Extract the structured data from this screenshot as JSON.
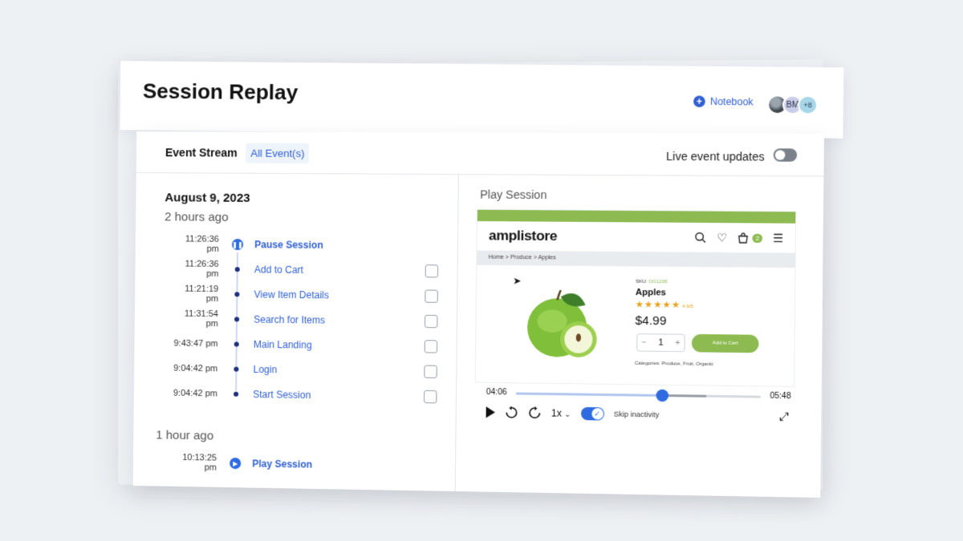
{
  "header": {
    "title": "Session Replay",
    "notebook_label": "Notebook",
    "avatars": [
      "BM",
      "+8"
    ]
  },
  "event_stream": {
    "title": "Event Stream",
    "filter": "All Event(s)",
    "live_label": "Live event updates",
    "live_enabled": false,
    "groups": [
      {
        "date": "August 9, 2023",
        "ago": "2 hours ago",
        "events": [
          {
            "time": "11:26:36 pm",
            "name": "Pause Session",
            "icon": "pause-icon"
          },
          {
            "time": "11:26:36 pm",
            "name": "Add to Cart",
            "icon": "dot"
          },
          {
            "time": "11:21:19 pm",
            "name": "View Item Details",
            "icon": "dot"
          },
          {
            "time": "11:31:54 pm",
            "name": "Search for Items",
            "icon": "dot"
          },
          {
            "time": "9:43:47 pm",
            "name": "Main Landing",
            "icon": "dot"
          },
          {
            "time": "9:04:42 pm",
            "name": "Login",
            "icon": "dot"
          },
          {
            "time": "9:04:42 pm",
            "name": "Start Session",
            "icon": "dot"
          }
        ]
      },
      {
        "ago": "1 hour ago",
        "events": [
          {
            "time": "10:13:25 pm",
            "name": "Play Session",
            "icon": "play-icon"
          }
        ]
      }
    ]
  },
  "player": {
    "label": "Play Session",
    "store": {
      "logo": "amplistore",
      "cart_count": "2",
      "breadcrumb": "Home  >  Produce  >  Apples",
      "sku_label": "SKU:",
      "sku": "OG1295",
      "product_name": "Apples",
      "rating": "4.9/5",
      "price": "$4.99",
      "quantity": "1",
      "add_to_cart": "Add to Cart",
      "categories": "Categories: Produce, Fruit, Organic"
    },
    "current_time": "04:06",
    "end_time": "05:48",
    "progress": 0.598,
    "buffered": 0.78,
    "speed": "1x",
    "skip_inactivity_label": "Skip inactivity",
    "skip_inactivity": true
  },
  "colors": {
    "accent": "#2f6be0",
    "store_green": "#8dbb52",
    "link": "#2f5fd0"
  }
}
